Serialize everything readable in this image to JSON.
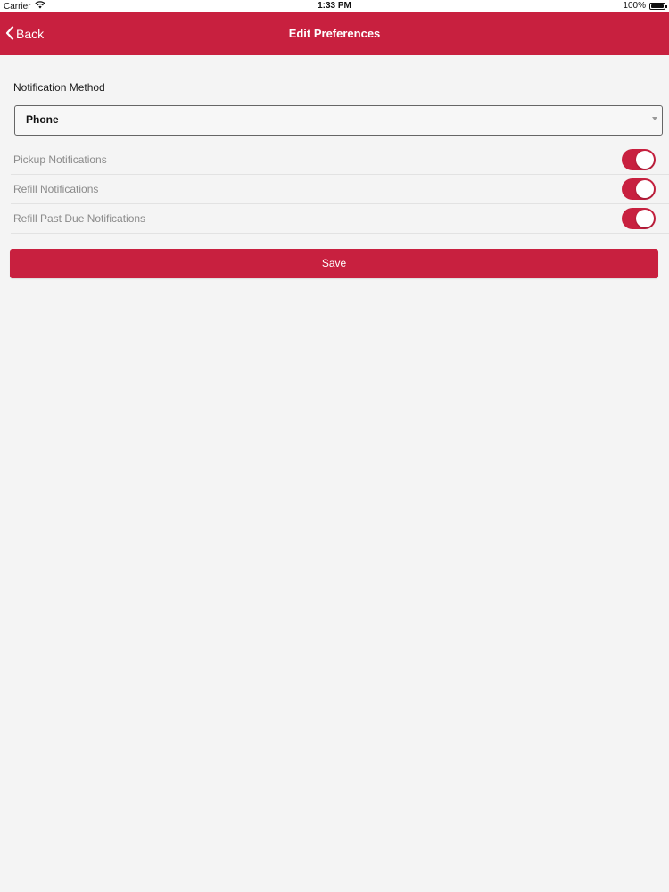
{
  "status_bar": {
    "carrier": "Carrier",
    "time": "1:33 PM",
    "battery": "100%",
    "battery_level": 1.0
  },
  "nav": {
    "back_label": "Back",
    "title": "Edit Preferences"
  },
  "form": {
    "notification_method_label": "Notification Method",
    "notification_method_value": "Phone",
    "toggles": [
      {
        "label": "Pickup Notifications",
        "on": true
      },
      {
        "label": "Refill Notifications",
        "on": true
      },
      {
        "label": "Refill Past Due Notifications",
        "on": true
      }
    ],
    "save_label": "Save"
  },
  "colors": {
    "accent": "#c8203f",
    "background": "#f4f4f4"
  },
  "icons": {
    "wifi": "wifi-icon",
    "battery": "battery-icon",
    "back": "chevron-left-icon",
    "dropdown": "caret-down-icon"
  }
}
